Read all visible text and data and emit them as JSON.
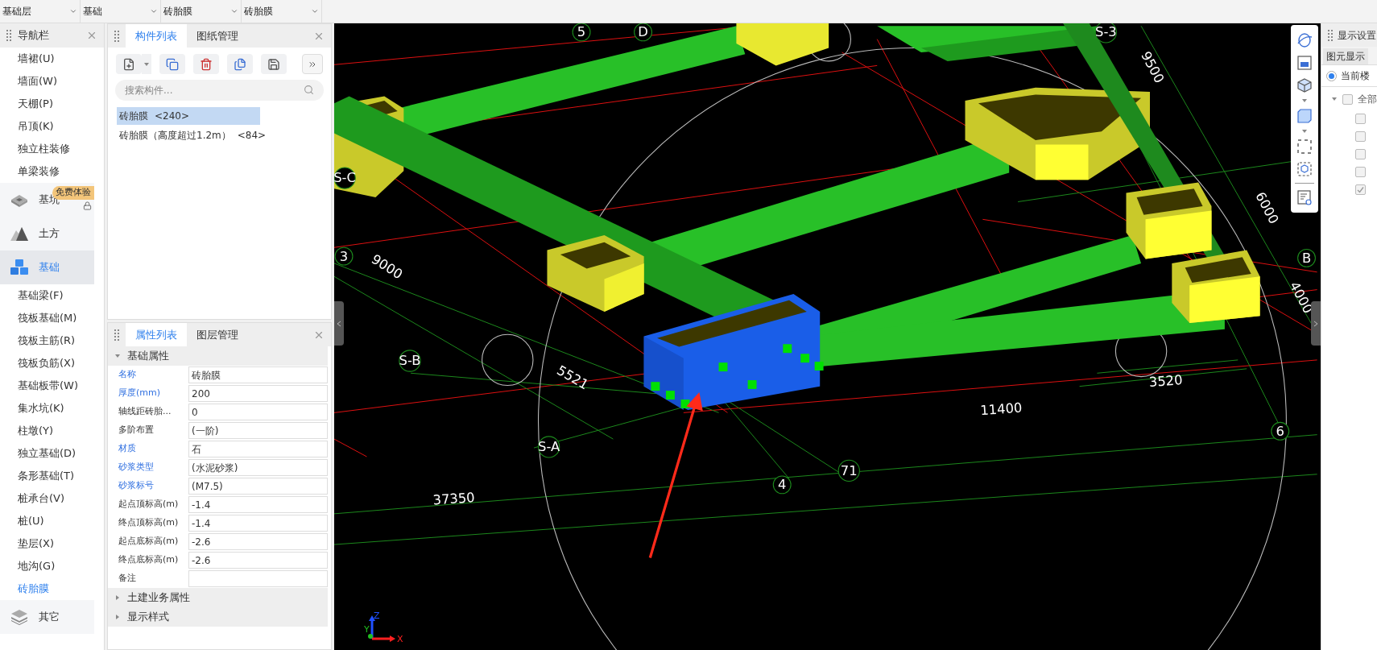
{
  "top_bar": {
    "dropdowns": [
      {
        "value": "基础层"
      },
      {
        "value": "基础"
      },
      {
        "value": "砖胎膜"
      },
      {
        "value": "砖胎膜"
      }
    ]
  },
  "nav": {
    "title": "导航栏",
    "items": [
      {
        "kind": "item",
        "label": "墙裙(U)",
        "selected": false
      },
      {
        "kind": "item",
        "label": "墙面(W)",
        "selected": false
      },
      {
        "kind": "item",
        "label": "天棚(P)",
        "selected": false
      },
      {
        "kind": "item",
        "label": "吊顶(K)",
        "selected": false
      },
      {
        "kind": "item",
        "label": "独立柱装修",
        "selected": false
      },
      {
        "kind": "item",
        "label": "单梁装修",
        "selected": false
      },
      {
        "kind": "group",
        "label": "基坑",
        "badge": "免费体验",
        "locked": true,
        "selected": false
      },
      {
        "kind": "group",
        "label": "土方",
        "locked": false,
        "selected": false
      },
      {
        "kind": "group",
        "label": "基础",
        "locked": false,
        "selected": true
      },
      {
        "kind": "item",
        "label": "基础梁(F)",
        "selected": false
      },
      {
        "kind": "item",
        "label": "筏板基础(M)",
        "selected": false
      },
      {
        "kind": "item",
        "label": "筏板主筋(R)",
        "selected": false
      },
      {
        "kind": "item",
        "label": "筏板负筋(X)",
        "selected": false
      },
      {
        "kind": "item",
        "label": "基础板带(W)",
        "selected": false
      },
      {
        "kind": "item",
        "label": "集水坑(K)",
        "selected": false
      },
      {
        "kind": "item",
        "label": "柱墩(Y)",
        "selected": false
      },
      {
        "kind": "item",
        "label": "独立基础(D)",
        "selected": false
      },
      {
        "kind": "item",
        "label": "条形基础(T)",
        "selected": false
      },
      {
        "kind": "item",
        "label": "桩承台(V)",
        "selected": false
      },
      {
        "kind": "item",
        "label": "桩(U)",
        "selected": false
      },
      {
        "kind": "item",
        "label": "垫层(X)",
        "selected": false
      },
      {
        "kind": "item",
        "label": "地沟(G)",
        "selected": false
      },
      {
        "kind": "item",
        "label": "砖胎膜",
        "selected": true
      },
      {
        "kind": "group",
        "label": "其它",
        "locked": false,
        "selected": false
      }
    ]
  },
  "component_panel": {
    "tabs": [
      {
        "label": "构件列表",
        "selected": true
      },
      {
        "label": "图纸管理",
        "selected": false
      }
    ],
    "search": {
      "placeholder": "搜索构件..."
    },
    "items": [
      {
        "name": "砖胎膜",
        "count": "<240>",
        "selected": true
      },
      {
        "name": "砖胎膜（高度超过1.2m）",
        "count": "<84>",
        "selected": false
      }
    ]
  },
  "property_panel": {
    "tabs": [
      {
        "label": "属性列表",
        "selected": true
      },
      {
        "label": "图层管理",
        "selected": false
      }
    ],
    "sections": [
      {
        "title": "基础属性",
        "expanded": true,
        "rows": [
          {
            "label": "名称",
            "value": "砖胎膜",
            "public": true
          },
          {
            "label": "厚度(mm)",
            "value": "200",
            "public": true
          },
          {
            "label": "轴线距砖胎...",
            "value": "0",
            "public": false
          },
          {
            "label": "多阶布置",
            "value": "(一阶)",
            "public": false
          },
          {
            "label": "材质",
            "value": "石",
            "public": true
          },
          {
            "label": "砂浆类型",
            "value": "(水泥砂浆)",
            "public": true
          },
          {
            "label": "砂浆标号",
            "value": "(M7.5)",
            "public": true
          },
          {
            "label": "起点顶标高(m)",
            "value": "-1.4",
            "public": false
          },
          {
            "label": "终点顶标高(m)",
            "value": "-1.4",
            "public": false
          },
          {
            "label": "起点底标高(m)",
            "value": "-2.6",
            "public": false
          },
          {
            "label": "终点底标高(m)",
            "value": "-2.6",
            "public": false
          },
          {
            "label": "备注",
            "value": "",
            "public": false
          }
        ]
      },
      {
        "title": "土建业务属性",
        "expanded": false
      },
      {
        "title": "显示样式",
        "expanded": false
      }
    ]
  },
  "viewport": {
    "labels": [
      {
        "kind": "axis",
        "text": "5"
      },
      {
        "kind": "axis",
        "text": "D"
      },
      {
        "kind": "axis",
        "text": "S-3"
      },
      {
        "kind": "dimension",
        "text": "9500"
      },
      {
        "kind": "axis",
        "text": "S-C"
      },
      {
        "kind": "axis",
        "text": "3"
      },
      {
        "kind": "dimension",
        "text": "9000"
      },
      {
        "kind": "dimension",
        "text": "6000"
      },
      {
        "kind": "axis",
        "text": "B"
      },
      {
        "kind": "dimension",
        "text": "4000"
      },
      {
        "kind": "axis",
        "text": "S-B"
      },
      {
        "kind": "dimension",
        "text": "5521"
      },
      {
        "kind": "dimension",
        "text": "3520"
      },
      {
        "kind": "dimension",
        "text": "11400"
      },
      {
        "kind": "axis",
        "text": "6"
      },
      {
        "kind": "axis",
        "text": "S-A"
      },
      {
        "kind": "axis",
        "text": "71"
      },
      {
        "kind": "axis",
        "text": "4"
      },
      {
        "kind": "dimension",
        "text": "37350"
      }
    ],
    "triad": {
      "x": "X",
      "y": "Y",
      "z": "Z"
    }
  },
  "display_settings": {
    "title": "显示设置",
    "tabs": [
      {
        "label": "图元显示",
        "selected": true
      }
    ],
    "scope": {
      "label": "当前楼",
      "selected": true
    },
    "tree": {
      "label": "全部",
      "expanded": true,
      "checked": false,
      "children": [
        {
          "checked": false
        },
        {
          "checked": false
        },
        {
          "checked": false
        },
        {
          "checked": false
        },
        {
          "checked": true
        }
      ]
    }
  }
}
